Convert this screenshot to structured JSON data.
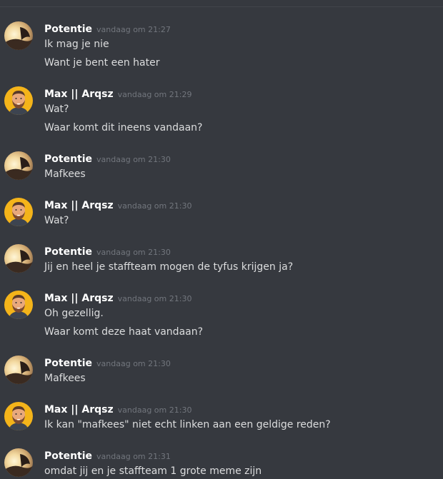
{
  "colors": {
    "background": "#36393f",
    "username": "#ffffff",
    "timestamp": "#72767d",
    "message_text": "#dcddde"
  },
  "users": {
    "potentie": {
      "name": "Potentie",
      "avatar_icon": "sunset-photo-avatar"
    },
    "max": {
      "name": "Max || Arqsz",
      "avatar_icon": "bearded-man-avatar"
    }
  },
  "messages": [
    {
      "author": "Potentie",
      "timestamp": "vandaag om 21:27",
      "lines": [
        "Ik mag je nie",
        "Want je bent een hater"
      ]
    },
    {
      "author": "Max || Arqsz",
      "timestamp": "vandaag om 21:29",
      "lines": [
        "Wat?",
        "Waar komt dit ineens vandaan?"
      ]
    },
    {
      "author": "Potentie",
      "timestamp": "vandaag om 21:30",
      "lines": [
        "Mafkees"
      ]
    },
    {
      "author": "Max || Arqsz",
      "timestamp": "vandaag om 21:30",
      "lines": [
        "Wat?"
      ]
    },
    {
      "author": "Potentie",
      "timestamp": "vandaag om 21:30",
      "lines": [
        "Jij en heel je staffteam mogen de tyfus krijgen ja?"
      ]
    },
    {
      "author": "Max || Arqsz",
      "timestamp": "vandaag om 21:30",
      "lines": [
        "Oh gezellig.",
        "Waar komt deze haat vandaan?"
      ]
    },
    {
      "author": "Potentie",
      "timestamp": "vandaag om 21:30",
      "lines": [
        "Mafkees"
      ]
    },
    {
      "author": "Max || Arqsz",
      "timestamp": "vandaag om 21:30",
      "lines": [
        "Ik kan \"mafkees\" niet echt linken aan een geldige reden?"
      ]
    },
    {
      "author": "Potentie",
      "timestamp": "vandaag om 21:31",
      "lines": [
        "omdat jij en je staffteam 1 grote meme zijn"
      ]
    }
  ]
}
